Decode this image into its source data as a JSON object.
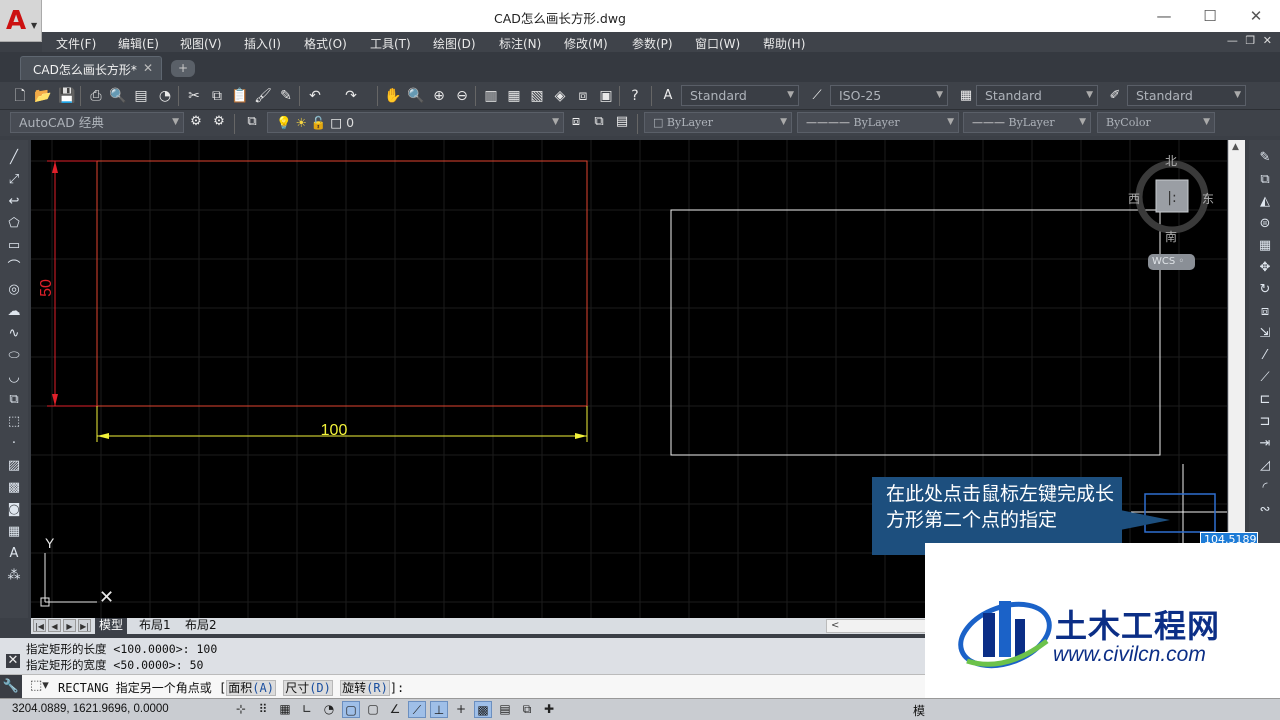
{
  "window": {
    "title": "CAD怎么画长方形.dwg"
  },
  "menu": [
    "文件(F)",
    "编辑(E)",
    "视图(V)",
    "插入(I)",
    "格式(O)",
    "工具(T)",
    "绘图(D)",
    "标注(N)",
    "修改(M)",
    "参数(P)",
    "窗口(W)",
    "帮助(H)"
  ],
  "tabs": {
    "active": "CAD怎么画长方形*"
  },
  "styles": {
    "text_style": "Standard",
    "dim_style": "ISO-25",
    "table_style": "Standard",
    "mleader_style": "Standard"
  },
  "workspace": "AutoCAD 经典",
  "layer": "0",
  "properties": {
    "color": "ByLayer",
    "linetype": "ByLayer",
    "lineweight": "ByLayer",
    "plotstyle": "ByColor"
  },
  "drawing": {
    "dim_horizontal": "100",
    "dim_vertical": "50",
    "ucs_y": "Y",
    "accent_red": "#e0202a",
    "dim_yellow": "#f2f23a",
    "rect_white": "#f0f0f0"
  },
  "viewcube": {
    "north": "北",
    "south": "南",
    "west": "西",
    "east": "东",
    "wcs": "WCS"
  },
  "layout_tabs": [
    "模型",
    "布局1",
    "布局2"
  ],
  "command": {
    "history": [
      "指定矩形的长度 <100.0000>: 100",
      "指定矩形的宽度 <50.0000>: 50"
    ],
    "prompt": "RECTANG 指定另一个角点或 [",
    "opt1": "面积",
    "opt1_key": "(A)",
    "opt2": "尺寸",
    "opt2_key": "(D)",
    "opt3": "旋转",
    "opt3_key": "(R)",
    "prompt_end": "]:"
  },
  "status": {
    "coordinates": "3204.0889, 1621.9696, 0.0000",
    "model": "模"
  },
  "tooltip": {
    "text": "在此处点击鼠标左键完成长方形第二个点的指定"
  },
  "dynamic_input": "104.5189",
  "watermark": {
    "title": "土木工程网",
    "url": "www.civilcn.com"
  }
}
